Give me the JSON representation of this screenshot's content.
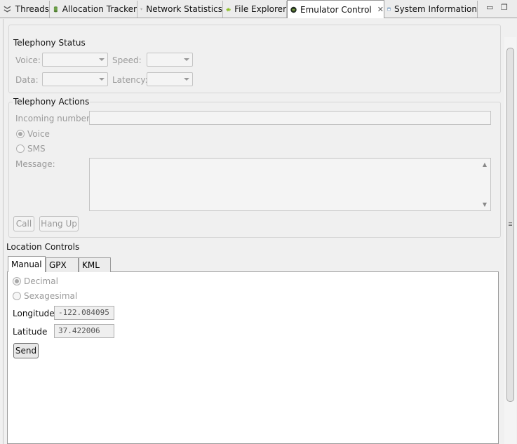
{
  "tabs": [
    {
      "label": "Threads",
      "icon": "threads-icon"
    },
    {
      "label": "Allocation Tracker",
      "icon": "database-icon"
    },
    {
      "label": "Network Statistics",
      "icon": "wifi-icon"
    },
    {
      "label": "File Explorer",
      "icon": "android-icon"
    },
    {
      "label": "Emulator Control",
      "icon": "phone-icon",
      "active": true,
      "close": "✕"
    },
    {
      "label": "System Information",
      "icon": "window-icon"
    }
  ],
  "window_controls": {
    "minimize": "▭",
    "restore": "❐"
  },
  "telephony_status": {
    "title": "Telephony Status",
    "voice_label": "Voice:",
    "speed_label": "Speed:",
    "data_label": "Data:",
    "latency_label": "Latency:"
  },
  "telephony_actions": {
    "title": "Telephony Actions",
    "incoming_label": "Incoming number:",
    "incoming_value": "",
    "voice_option": "Voice",
    "sms_option": "SMS",
    "message_label": "Message:",
    "call_button": "Call",
    "hangup_button": "Hang Up"
  },
  "location": {
    "title": "Location Controls",
    "tabs": [
      "Manual",
      "GPX",
      "KML"
    ],
    "decimal_option": "Decimal",
    "sexagesimal_option": "Sexagesimal",
    "longitude_label": "Longitude",
    "longitude_value": "-122.084095",
    "latitude_label": "Latitude",
    "latitude_value": "37.422006",
    "send_button": "Send"
  }
}
